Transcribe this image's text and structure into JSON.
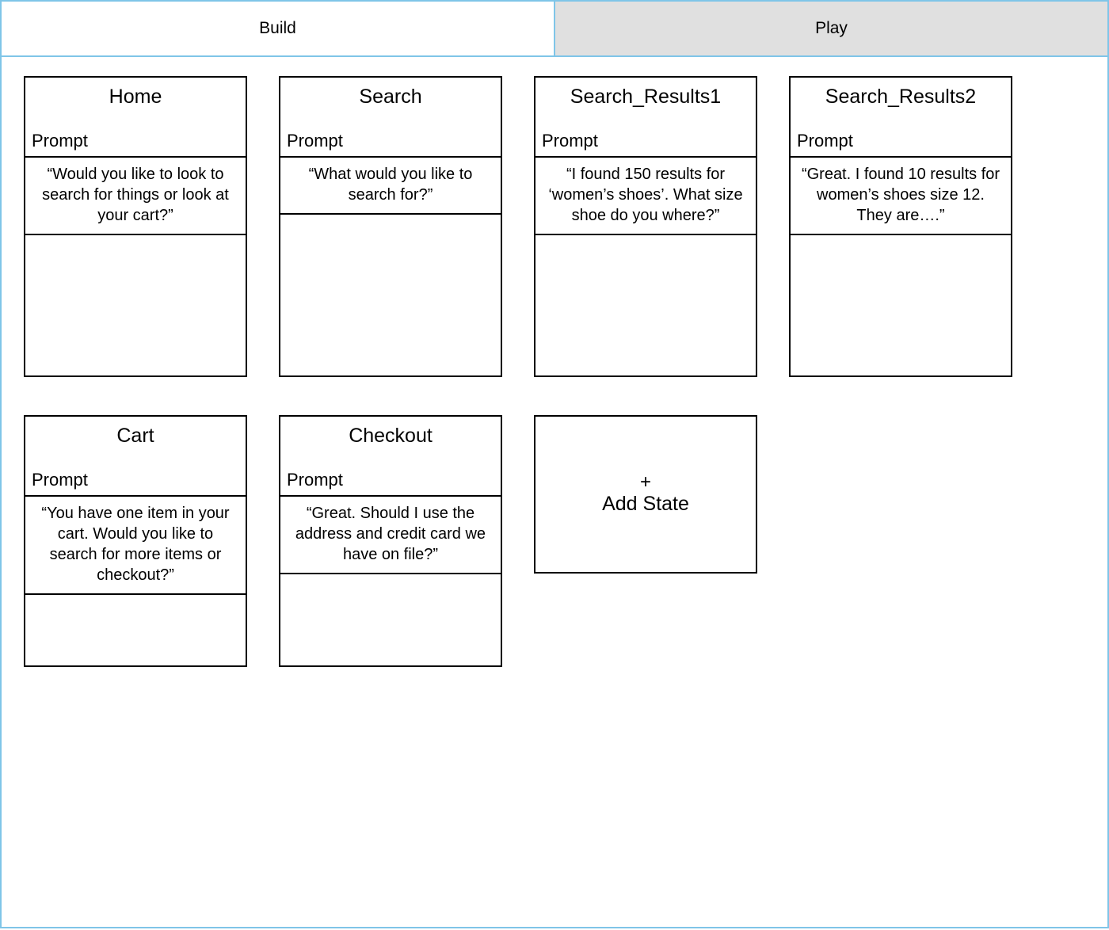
{
  "tabs": {
    "build": "Build",
    "play": "Play"
  },
  "prompt_label": "Prompt",
  "states": [
    {
      "title": "Home",
      "prompt": "“Would you like to look to search for things or look at your cart?”"
    },
    {
      "title": "Search",
      "prompt": "“What would you like to search for?”"
    },
    {
      "title": "Search_Results1",
      "prompt": "“I found 150 results for ‘women’s shoes’. What size shoe do you where?”"
    },
    {
      "title": "Search_Results2",
      "prompt": "“Great. I found 10 results for women’s shoes size 12. They are….”"
    },
    {
      "title": "Cart",
      "prompt": "“You have one item in your cart. Would you like to search for more items or checkout?”"
    },
    {
      "title": "Checkout",
      "prompt": "“Great. Should I use the address and credit card we have on file?”"
    }
  ],
  "add_state": {
    "plus": "+",
    "label": "Add State"
  }
}
